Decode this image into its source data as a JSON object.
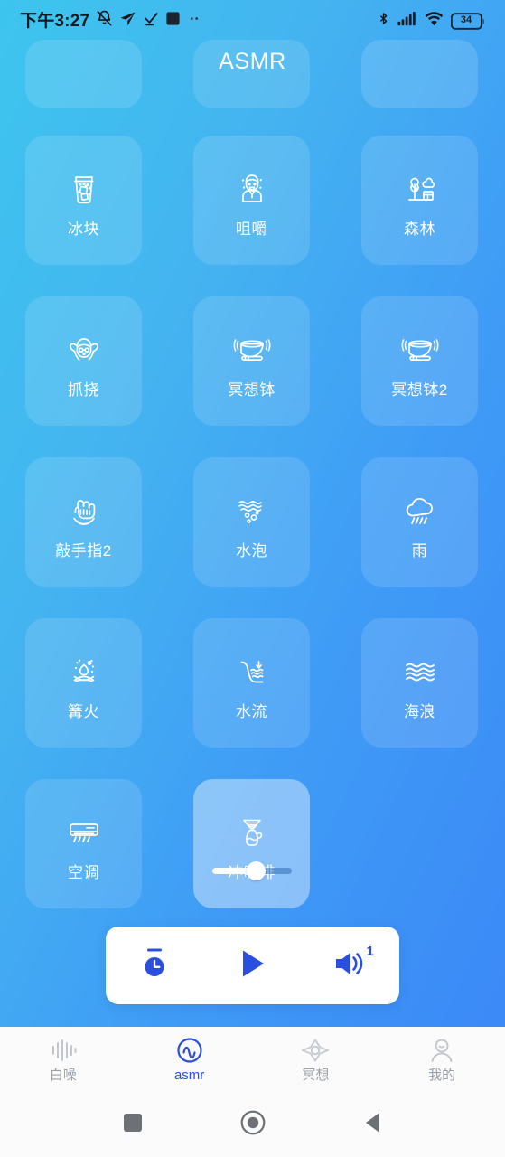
{
  "statusbar": {
    "time": "下午3:27",
    "left_icons": [
      "bell-mute-icon",
      "send-icon",
      "check-download-icon",
      "square-app-icon",
      "more-dots-icon"
    ],
    "right_icons": [
      "bluetooth-icon",
      "signal-bars-icon",
      "wifi-icon",
      "battery-icon"
    ],
    "battery_level": "34"
  },
  "header": {
    "title": "ASMR"
  },
  "colors": {
    "bg_start": "#3dc5ee",
    "bg_end": "#3b86f7",
    "accent": "#2a4fe0",
    "card_bg": "rgba(255,255,255,.13)",
    "card_selected_bg": "rgba(255,255,255,.40)",
    "tab_inactive": "#9aa0a8"
  },
  "grid": {
    "items": [
      {
        "label": "冰块",
        "icon": "ice-cubes-glass-icon",
        "selected": false
      },
      {
        "label": "咀嚼",
        "icon": "chewing-person-icon",
        "selected": false
      },
      {
        "label": "森林",
        "icon": "forest-tree-icon",
        "selected": false
      },
      {
        "label": "抓挠",
        "icon": "scratching-head-icon",
        "selected": false
      },
      {
        "label": "冥想钵",
        "icon": "singing-bowl-icon",
        "selected": false
      },
      {
        "label": "冥想钵2",
        "icon": "singing-bowl-2-icon",
        "selected": false
      },
      {
        "label": "敲手指2",
        "icon": "finger-tapping-2-icon",
        "selected": false
      },
      {
        "label": "水泡",
        "icon": "bubbles-icon",
        "selected": false
      },
      {
        "label": "雨",
        "icon": "rain-cloud-icon",
        "selected": false
      },
      {
        "label": "篝火",
        "icon": "campfire-icon",
        "selected": false
      },
      {
        "label": "水流",
        "icon": "water-stream-icon",
        "selected": false
      },
      {
        "label": "海浪",
        "icon": "ocean-waves-icon",
        "selected": false
      },
      {
        "label": "空调",
        "icon": "air-conditioner-icon",
        "selected": false
      },
      {
        "label": "冲咖啡",
        "icon": "coffee-brewing-icon",
        "selected": true
      }
    ]
  },
  "item_volume": {
    "value": 55,
    "name": "冲咖啡"
  },
  "player": {
    "timer_icon": "timer-icon",
    "play_icon": "play-icon",
    "volume_icon": "volume-icon",
    "volume_badge": "1"
  },
  "tabbar": {
    "items": [
      {
        "label": "白噪",
        "icon": "white-noise-bars-icon",
        "active": false
      },
      {
        "label": "asmr",
        "icon": "asmr-wave-circle-icon",
        "active": true
      },
      {
        "label": "冥想",
        "icon": "meditation-star-icon",
        "active": false
      },
      {
        "label": "我的",
        "icon": "profile-person-icon",
        "active": false
      }
    ]
  },
  "navbar": {
    "items": [
      {
        "name": "recents-square-icon"
      },
      {
        "name": "home-circle-icon"
      },
      {
        "name": "back-triangle-icon"
      }
    ]
  }
}
